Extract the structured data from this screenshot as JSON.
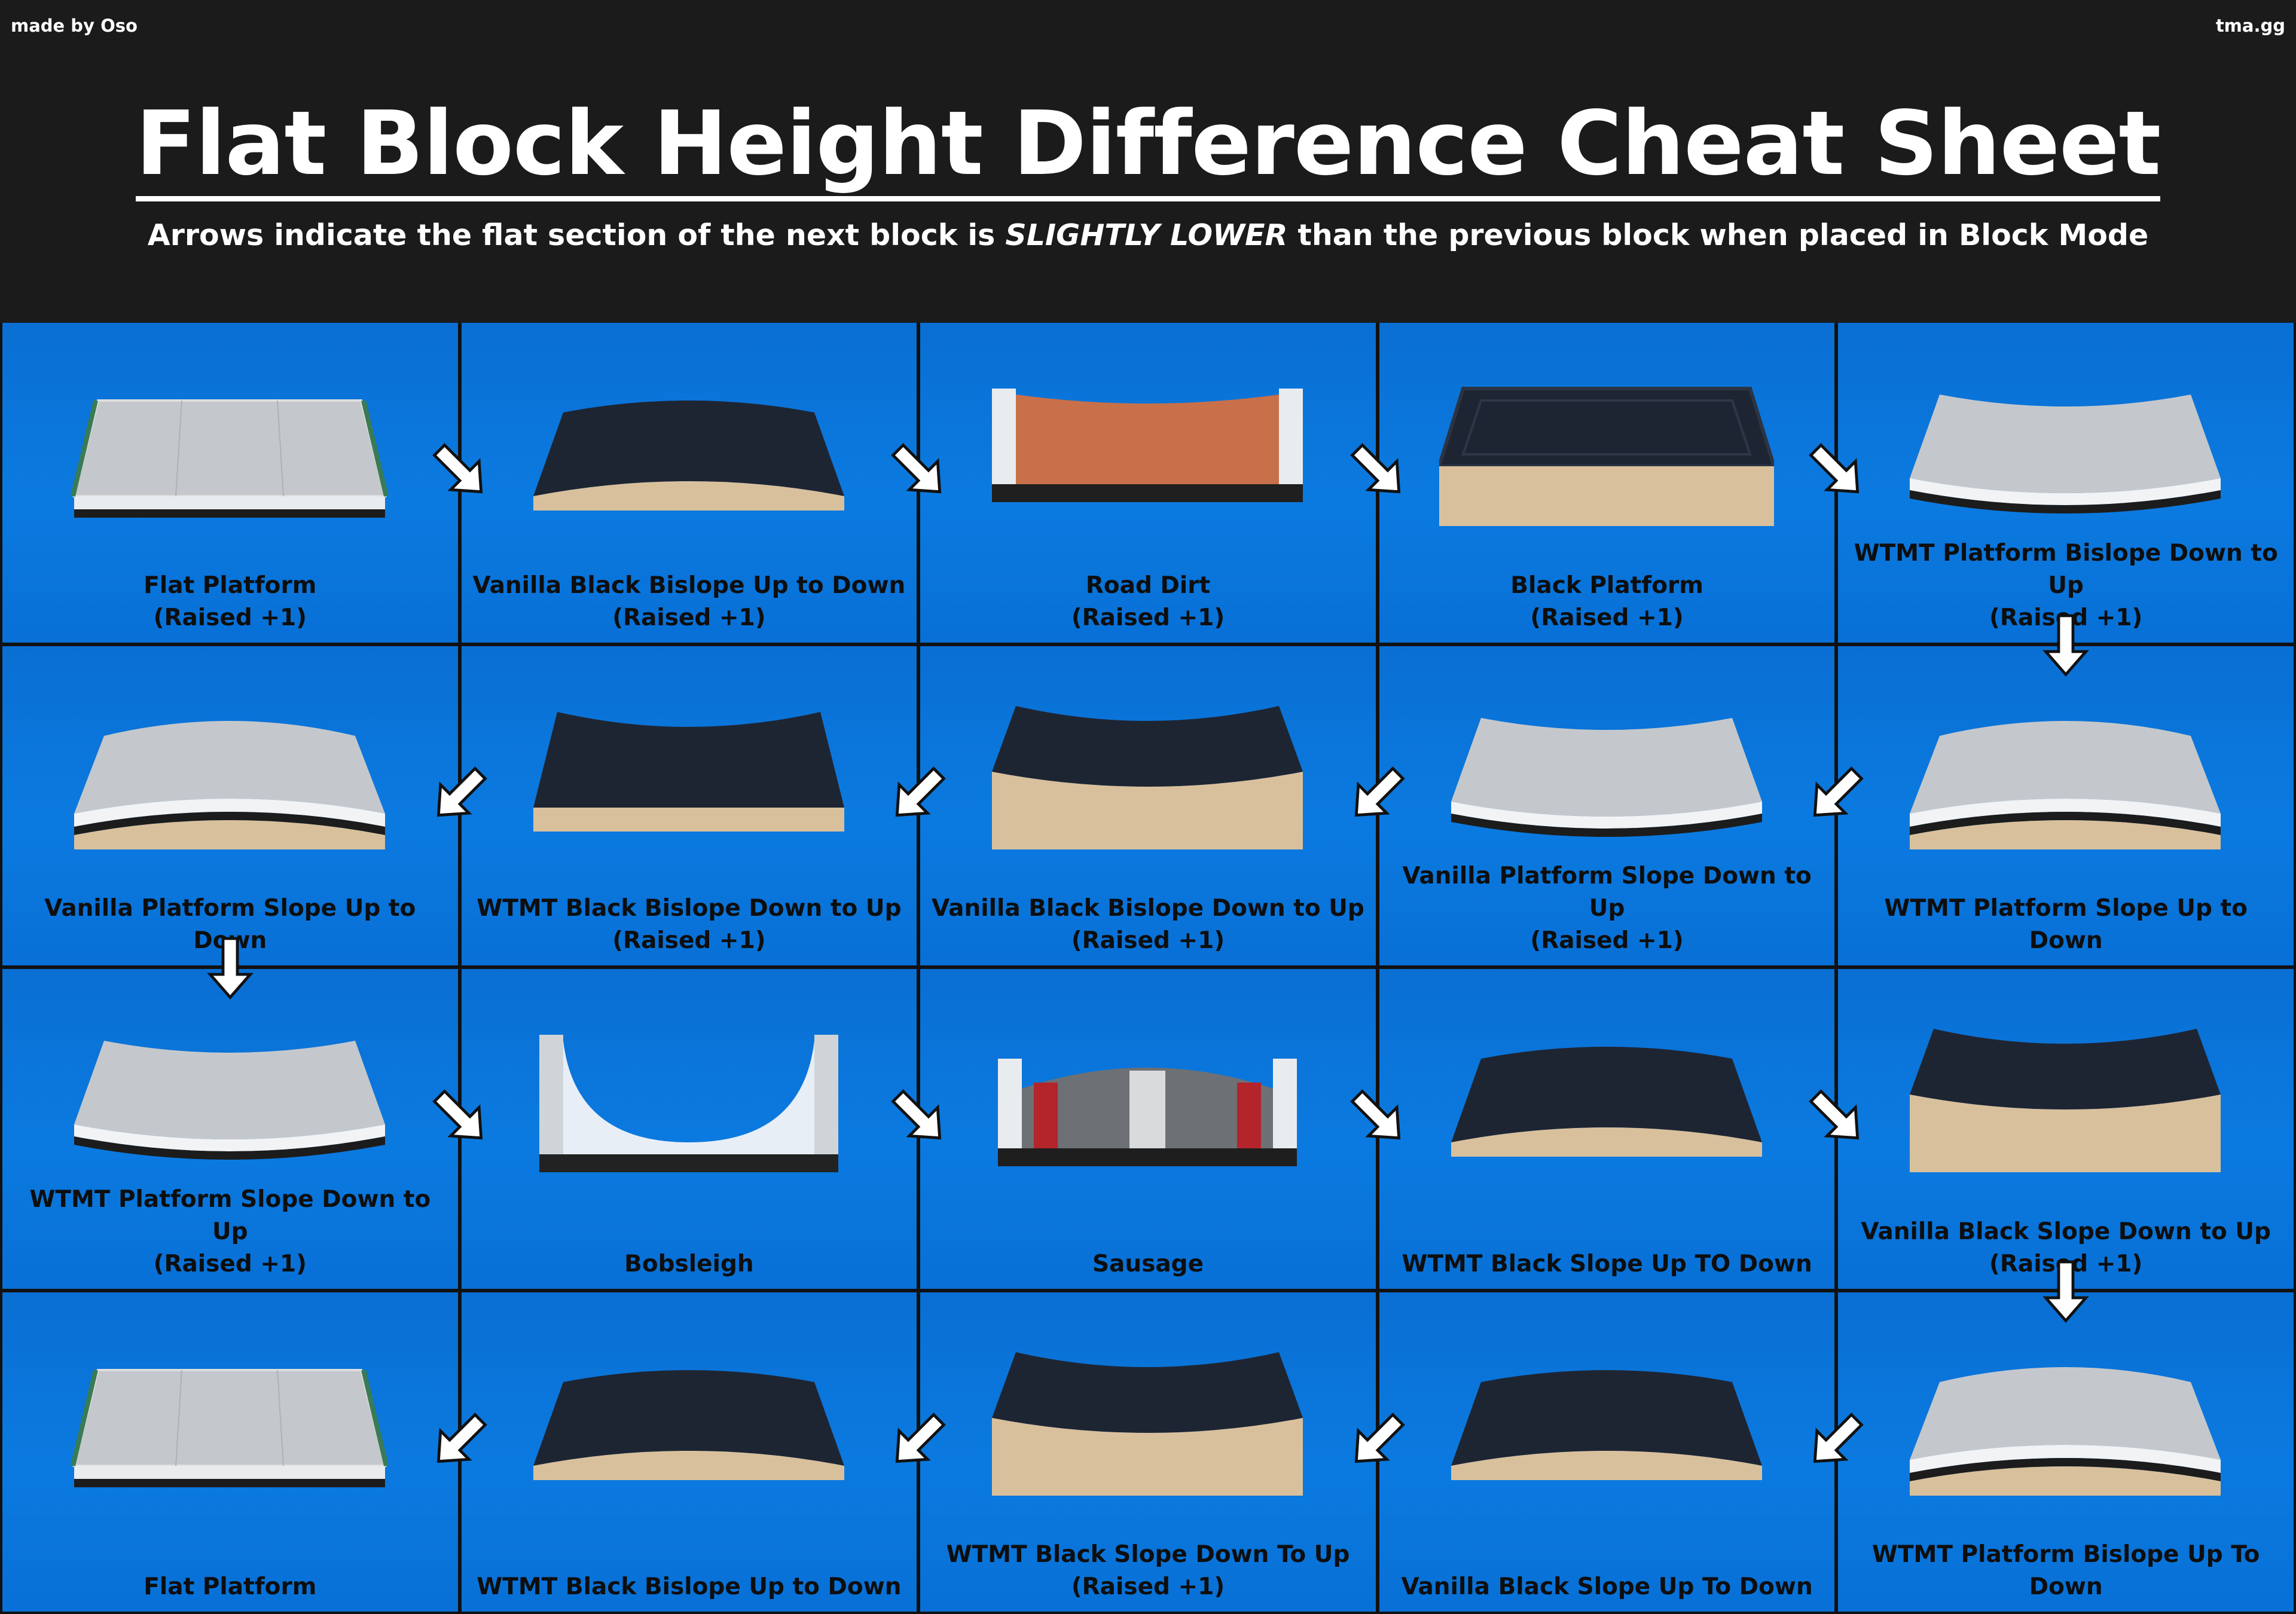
{
  "header": {
    "credit_left": "made by Oso",
    "credit_right": "tma.gg",
    "title": "Flat Block Height Difference Cheat Sheet",
    "subtitle_before": "Arrows indicate the flat section of the next block is ",
    "subtitle_emph": "SLIGHTLY LOWER",
    "subtitle_after": " than the previous block when placed in Block Mode"
  },
  "colors": {
    "cell_blue": "#0b7ae0",
    "header_bg": "#1b1b1b",
    "black_surface": "#1e2532",
    "wood": "#d9c09c",
    "platform_grey": "#c4c8cc"
  },
  "cells": [
    {
      "name": "Flat Platform",
      "sub": "(Raised +1)",
      "kind": "platform-flat"
    },
    {
      "name": "Vanilla Black Bislope Up to Down",
      "sub": "(Raised +1)",
      "kind": "black-hump"
    },
    {
      "name": "Road Dirt",
      "sub": "(Raised +1)",
      "kind": "road-dirt"
    },
    {
      "name": "Black Platform",
      "sub": "(Raised +1)",
      "kind": "black-box"
    },
    {
      "name": "WTMT Platform Bislope Down to Up",
      "sub": "(Raised +1)",
      "kind": "platform-dip"
    },
    {
      "name": "Vanilla Platform Slope Up to Down",
      "sub": "",
      "kind": "platform-hump"
    },
    {
      "name": "WTMT Black Bislope Down to Up",
      "sub": "(Raised +1)",
      "kind": "black-dip"
    },
    {
      "name": "Vanilla Black Bislope Down to Up",
      "sub": "(Raised +1)",
      "kind": "black-dip-wood"
    },
    {
      "name": "Vanilla Platform Slope Down to Up",
      "sub": "(Raised +1)",
      "kind": "platform-dip"
    },
    {
      "name": "WTMT Platform Slope Up to Down",
      "sub": "",
      "kind": "platform-hump"
    },
    {
      "name": "WTMT Platform Slope Down to Up",
      "sub": "(Raised +1)",
      "kind": "platform-dip"
    },
    {
      "name": "Bobsleigh",
      "sub": "",
      "kind": "bobsleigh"
    },
    {
      "name": "Sausage",
      "sub": "",
      "kind": "sausage"
    },
    {
      "name": "WTMT Black Slope Up TO Down",
      "sub": "",
      "kind": "black-hump"
    },
    {
      "name": "Vanilla Black Slope Down to Up",
      "sub": "(Raised +1)",
      "kind": "black-dip-wood"
    },
    {
      "name": "Flat Platform",
      "sub": "",
      "kind": "platform-flat"
    },
    {
      "name": "WTMT Black Bislope Up to Down",
      "sub": "",
      "kind": "black-hump"
    },
    {
      "name": "WTMT Black Slope Down To Up",
      "sub": "(Raised +1)",
      "kind": "black-dip-wood"
    },
    {
      "name": "Vanilla Black Slope Up To Down",
      "sub": "",
      "kind": "black-hump"
    },
    {
      "name": "WTMT Platform Bislope Up To Down",
      "sub": "",
      "kind": "platform-hump"
    }
  ],
  "arrows": [
    {
      "from": 1,
      "to": 2,
      "dir": "down-right"
    },
    {
      "from": 2,
      "to": 3,
      "dir": "down-right"
    },
    {
      "from": 3,
      "to": 4,
      "dir": "down-right"
    },
    {
      "from": 4,
      "to": 5,
      "dir": "down-right"
    },
    {
      "from": 5,
      "to": 10,
      "dir": "down"
    },
    {
      "from": 10,
      "to": 9,
      "dir": "down-left"
    },
    {
      "from": 9,
      "to": 8,
      "dir": "down-left"
    },
    {
      "from": 8,
      "to": 7,
      "dir": "down-left"
    },
    {
      "from": 7,
      "to": 6,
      "dir": "down-left"
    },
    {
      "from": 6,
      "to": 11,
      "dir": "down"
    },
    {
      "from": 11,
      "to": 12,
      "dir": "down-right"
    },
    {
      "from": 12,
      "to": 13,
      "dir": "down-right"
    },
    {
      "from": 13,
      "to": 14,
      "dir": "down-right"
    },
    {
      "from": 14,
      "to": 15,
      "dir": "down-right"
    },
    {
      "from": 15,
      "to": 20,
      "dir": "down"
    },
    {
      "from": 20,
      "to": 19,
      "dir": "down-left"
    },
    {
      "from": 19,
      "to": 18,
      "dir": "down-left"
    },
    {
      "from": 18,
      "to": 17,
      "dir": "down-left"
    },
    {
      "from": 17,
      "to": 16,
      "dir": "down-left"
    }
  ]
}
